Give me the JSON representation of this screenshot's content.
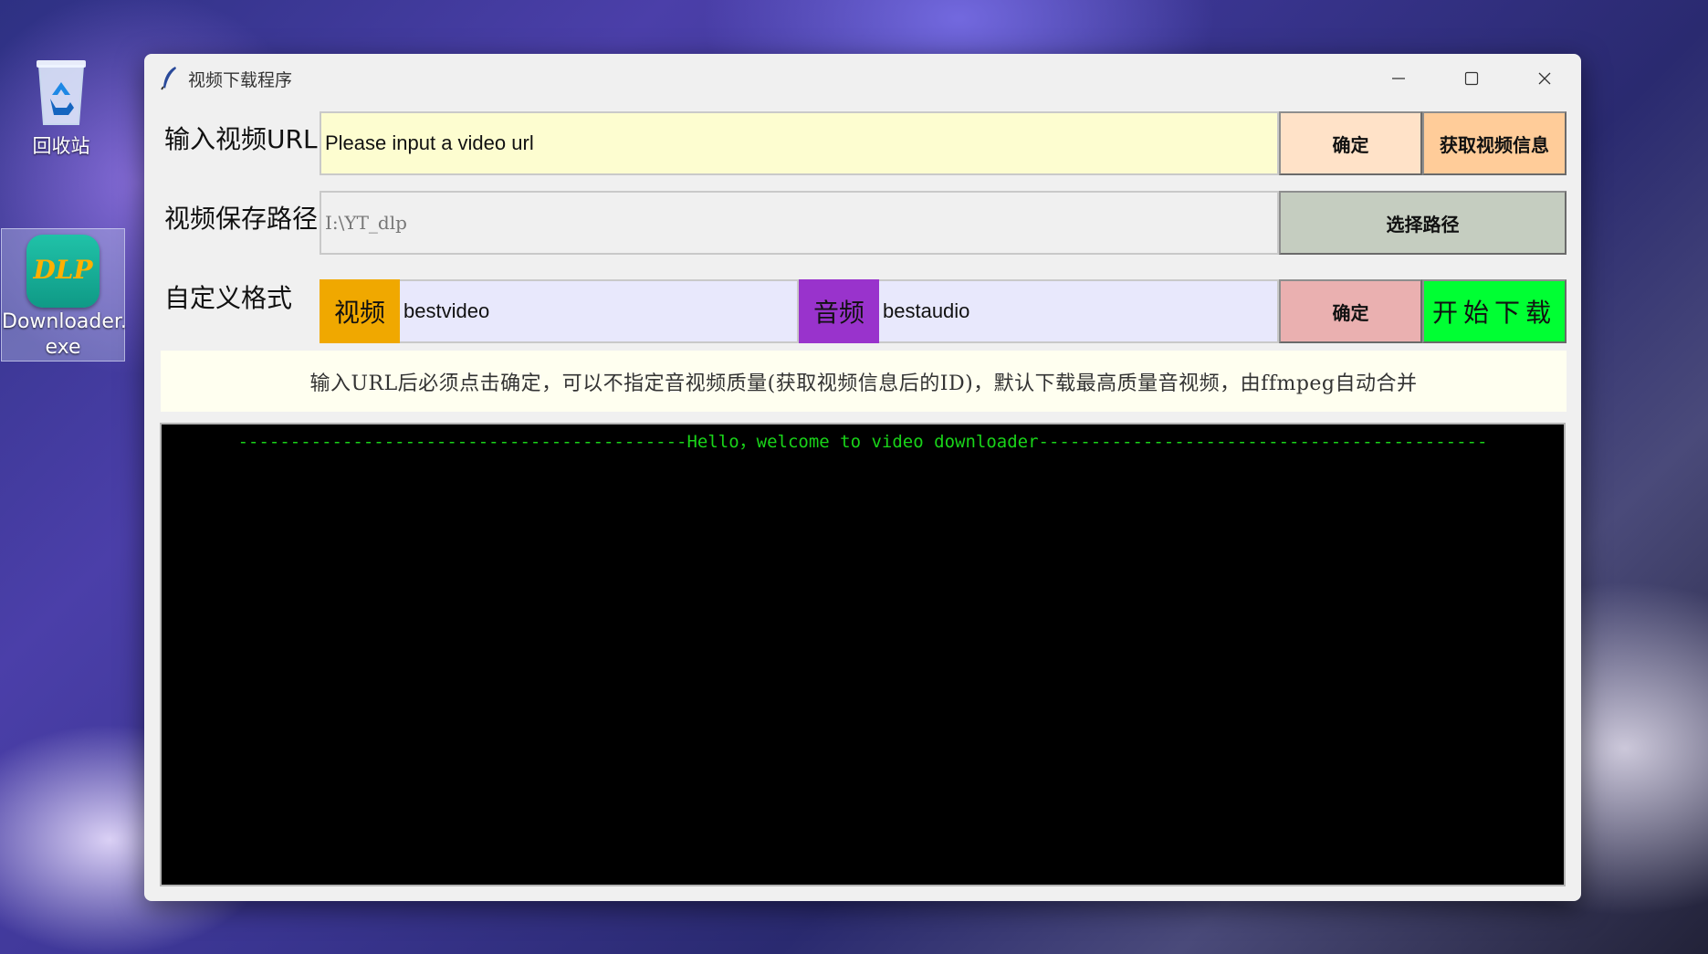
{
  "desktop": {
    "icons": [
      {
        "label": "回收站",
        "icon": "recycle-bin-icon"
      },
      {
        "label": "Downloader.exe",
        "label_line1": "Downloader.",
        "label_line2": "exe",
        "icon_text": "DLP",
        "icon": "dlp-app-icon"
      }
    ]
  },
  "window": {
    "title": "视频下载程序",
    "app_icon": "feather-icon",
    "controls": [
      "minimize-icon",
      "maximize-icon",
      "close-icon"
    ]
  },
  "url_row": {
    "label": "输入视频URL",
    "input_value": "Please input a video url",
    "confirm_label": "确定",
    "info_label": "获取视频信息",
    "colors": {
      "input_bg": "#fdfdd0",
      "confirm_bg": "#ffe2c8",
      "info_bg": "#ffcc99"
    }
  },
  "path_row": {
    "label": "视频保存路径",
    "input_value": "I:\\YT_dlp",
    "choose_label": "选择路径",
    "colors": {
      "input_bg": "#f0f0f0",
      "choose_bg": "#c5cdc0"
    }
  },
  "format_row": {
    "label": "自定义格式",
    "video_tag": "视频",
    "video_value": "bestvideo",
    "audio_tag": "音频",
    "audio_value": "bestaudio",
    "confirm_label": "确定",
    "download_label": "开始下载",
    "colors": {
      "video_tag_bg": "#f0a800",
      "audio_tag_bg": "#9933cc",
      "field_bg": "#e8e8fc",
      "confirm_bg": "#eab0b0",
      "download_bg": "#00ff33"
    }
  },
  "hint": "输入URL后必须点击确定，可以不指定音视频质量(获取视频信息后的ID)，默认下载最高质量音视频，由ffmpeg自动合并",
  "console": {
    "lines": [
      "-------------------------------------------Hello，welcome to video downloader-------------------------------------------"
    ],
    "colors": {
      "bg": "#000000",
      "fg": "#19d419"
    }
  }
}
